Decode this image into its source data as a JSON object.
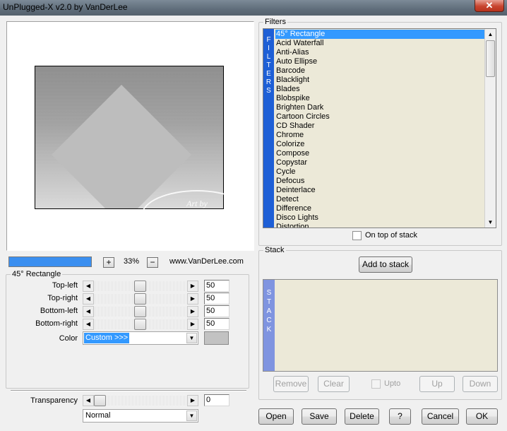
{
  "window": {
    "title": "UnPlugged-X v2.0 by VanDerLee",
    "close_label": "✕"
  },
  "preview": {
    "watermark_line1": "Art by",
    "watermark_line2": "Neusa Novaes",
    "progress_percent": 100,
    "zoom_in_label": "+",
    "zoom_value": "33%",
    "zoom_out_label": "−",
    "website": "www.VanDerLee.com"
  },
  "params": {
    "legend": "45° Rectangle",
    "rows": [
      {
        "label": "Top-left",
        "value": "50"
      },
      {
        "label": "Top-right",
        "value": "50"
      },
      {
        "label": "Bottom-left",
        "value": "50"
      },
      {
        "label": "Bottom-right",
        "value": "50"
      }
    ],
    "color_label": "Color",
    "color_value": "Custom >>>",
    "swatch_color": "#c2c2c2"
  },
  "transparency": {
    "label": "Transparency",
    "value": "0",
    "blend_mode": "Normal"
  },
  "filters": {
    "legend": "Filters",
    "side_label": [
      "F",
      "I",
      "L",
      "T",
      "E",
      "R",
      "S"
    ],
    "items": [
      "45° Rectangle",
      "Acid Waterfall",
      "Anti-Alias",
      "Auto Ellipse",
      "Barcode",
      "Blacklight",
      "Blades",
      "Blobspike",
      "Brighten Dark",
      "Cartoon Circles",
      "CD Shader",
      "Chrome",
      "Colorize",
      "Compose",
      "Copystar",
      "Cycle",
      "Defocus",
      "Deinterlace",
      "Detect",
      "Difference",
      "Disco Lights",
      "Distortion"
    ],
    "selected_index": 0,
    "on_top_label": "On top of stack",
    "accent_color": "#1e5fd6",
    "selection_color": "#3399ff"
  },
  "stack": {
    "legend": "Stack",
    "add_label": "Add to stack",
    "side_label": [
      "S",
      "T",
      "A",
      "C",
      "K"
    ],
    "remove_label": "Remove",
    "clear_label": "Clear",
    "upto_label": "Upto",
    "up_label": "Up",
    "down_label": "Down"
  },
  "footer": {
    "open_label": "Open",
    "save_label": "Save",
    "delete_label": "Delete",
    "help_label": "?",
    "cancel_label": "Cancel",
    "ok_label": "OK"
  }
}
